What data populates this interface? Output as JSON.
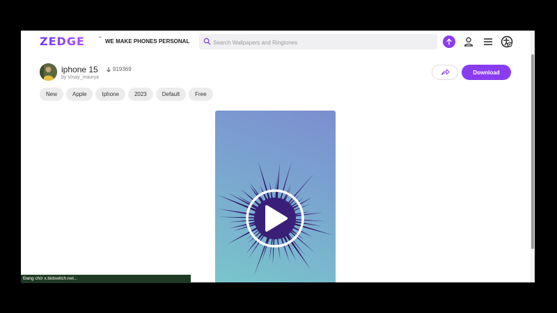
{
  "header": {
    "logo": "ZEDGE",
    "logo_tm": "™",
    "tagline": "WE MAKE PHONES PERSONAL",
    "search_placeholder": "Search Wallpapers and Ringtones"
  },
  "item": {
    "title": "iphone 15",
    "downloads": "919369",
    "author_prefix": "by",
    "author": "Vinay_maurya",
    "download_label": "Download"
  },
  "tags": [
    "New",
    "Apple",
    "Iphone",
    "2023",
    "Default",
    "Free"
  ],
  "icons": {
    "search": "search-icon",
    "upload": "arrow-up-icon",
    "user": "user-icon",
    "menu": "hamburger-menu-icon",
    "accessibility": "accessibility-icon",
    "share": "share-icon",
    "play": "play-icon"
  },
  "colors": {
    "accent": "#8a3df0"
  },
  "status_text": "Đang chờ x.bidswitch.net..."
}
